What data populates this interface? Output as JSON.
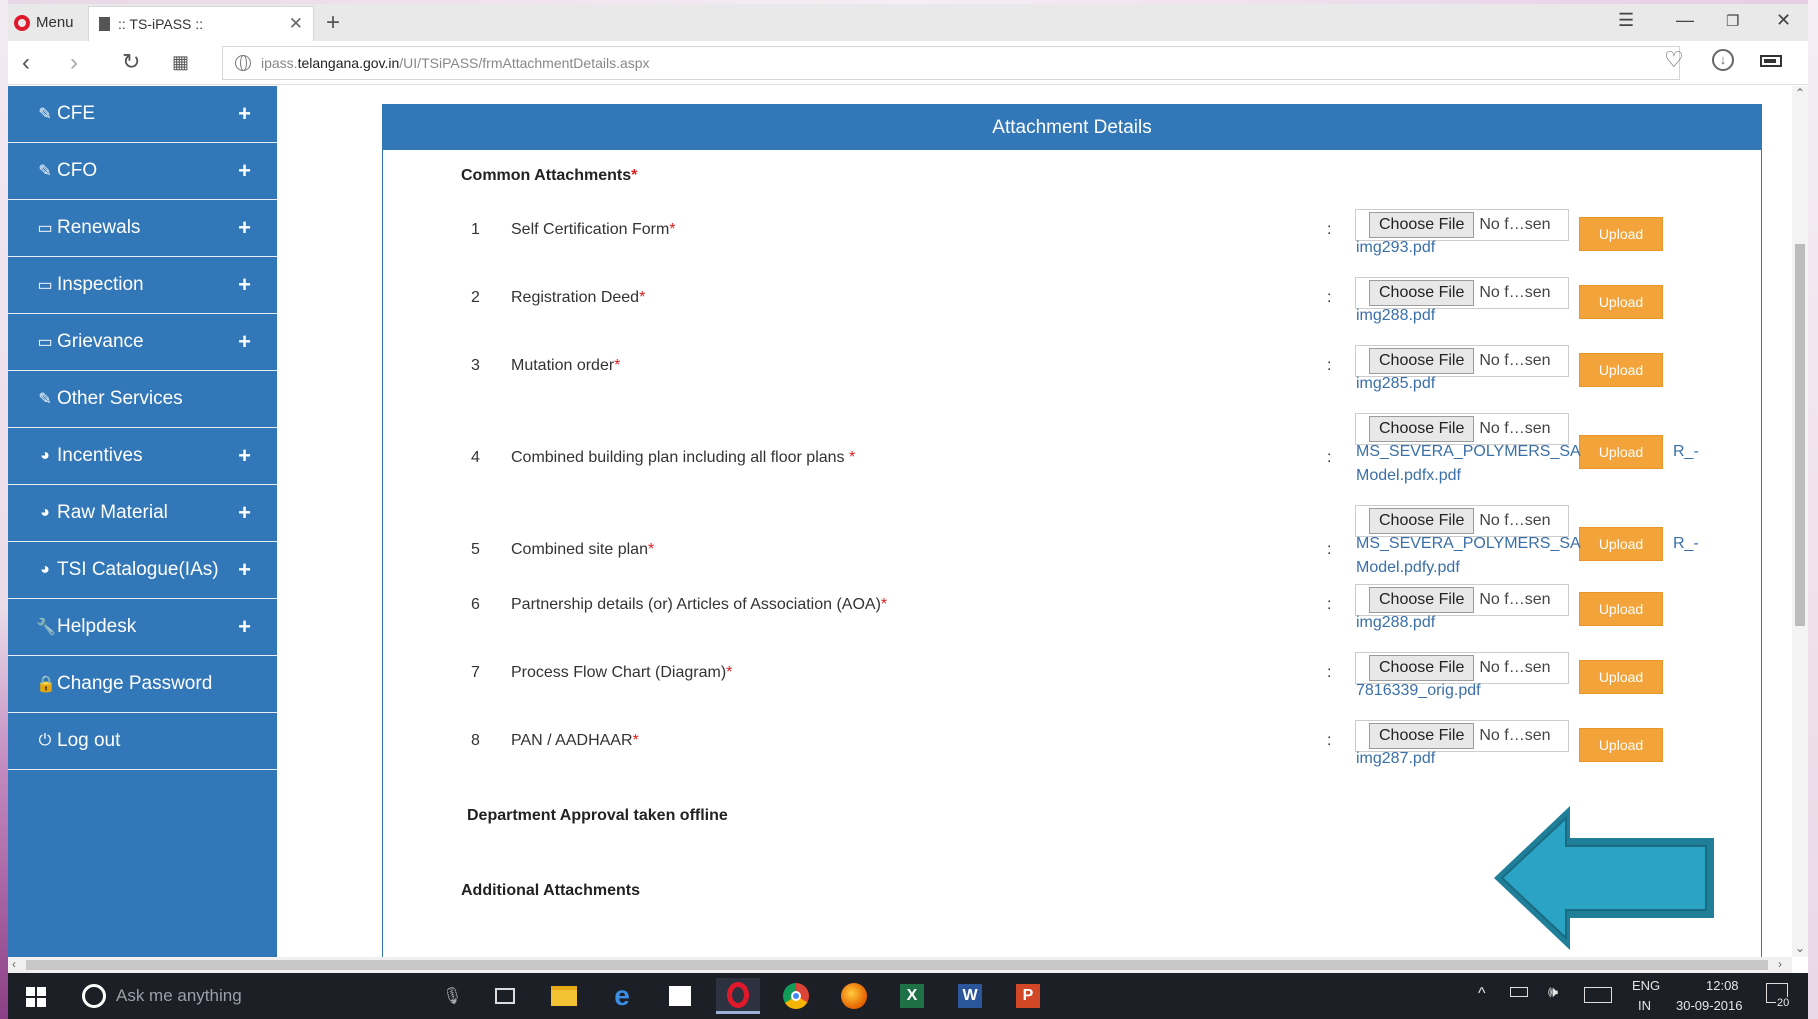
{
  "browser": {
    "menu_label": "Menu",
    "tab_title": ":: TS-iPASS ::",
    "url_prefix": "ipass.",
    "url_host": "telangana.gov.in",
    "url_path": "/UI/TSiPASS/frmAttachmentDetails.aspx"
  },
  "sidebar": {
    "items": [
      {
        "label": "CFE",
        "icon": "edit-icon",
        "expandable": "+"
      },
      {
        "label": "CFO",
        "icon": "edit-icon",
        "expandable": "+"
      },
      {
        "label": "Renewals",
        "icon": "monitor-icon",
        "expandable": "+"
      },
      {
        "label": "Inspection",
        "icon": "monitor-icon",
        "expandable": "+"
      },
      {
        "label": "Grievance",
        "icon": "monitor-icon",
        "expandable": "+"
      },
      {
        "label": "Other Services",
        "icon": "edit-icon",
        "expandable": ""
      },
      {
        "label": "Incentives",
        "icon": "dashboard-icon",
        "expandable": "+"
      },
      {
        "label": "Raw Material",
        "icon": "dashboard-icon",
        "expandable": "+"
      },
      {
        "label": "TSI Catalogue(IAs)",
        "icon": "dashboard-icon",
        "expandable": "+"
      },
      {
        "label": "Helpdesk",
        "icon": "wrench-icon",
        "expandable": "+"
      },
      {
        "label": "Change Password",
        "icon": "lock-icon",
        "expandable": ""
      },
      {
        "label": "Log out",
        "icon": "power-icon",
        "expandable": ""
      }
    ]
  },
  "panel": {
    "title": "Attachment Details",
    "common_title": "Common Attachments",
    "required_mark": "*",
    "choose_label": "Choose File",
    "no_file_text": "No f…sen",
    "upload_label": "Upload",
    "colon": ":",
    "rows": [
      {
        "num": "1",
        "label": "Self Certification Form",
        "req": "*",
        "file": "img293.pdf"
      },
      {
        "num": "2",
        "label": "Registration Deed",
        "req": "*",
        "file": "img288.pdf"
      },
      {
        "num": "3",
        "label": "Mutation order",
        "req": "*",
        "file": "img285.pdf"
      },
      {
        "num": "4",
        "label": "Combined building plan including all floor plans ",
        "req": "*",
        "file": "MS_SEVERA_POLYMERS_SA",
        "file_tail": "R_-",
        "file_line2": "Model.pdfx.pdf"
      },
      {
        "num": "5",
        "label": "Combined site plan",
        "req": "*",
        "file": "MS_SEVERA_POLYMERS_SA",
        "file_tail": "R_-",
        "file_line2": "Model.pdfy.pdf"
      },
      {
        "num": "6",
        "label": "Partnership details (or) Articles of Association (AOA)",
        "req": "*",
        "file": "img288.pdf"
      },
      {
        "num": "7",
        "label": "Process Flow Chart (Diagram)",
        "req": "*",
        "file": "7816339_orig.pdf"
      },
      {
        "num": "8",
        "label": "PAN / AADHAAR",
        "req": "*",
        "file": "img287.pdf"
      }
    ],
    "dept_title": "Department Approval taken offline",
    "additional_title": "Additional Attachments"
  },
  "taskbar": {
    "search_placeholder": "Ask me anything",
    "lang_top": "ENG",
    "lang_bottom": "IN",
    "time": "12:08",
    "date": "30-09-2016",
    "notif_count": "20"
  },
  "colors": {
    "sidebar": "#3277b8",
    "upload": "#f2a33a",
    "arrow": "#2aa3c4",
    "link": "#3a6fa8"
  }
}
